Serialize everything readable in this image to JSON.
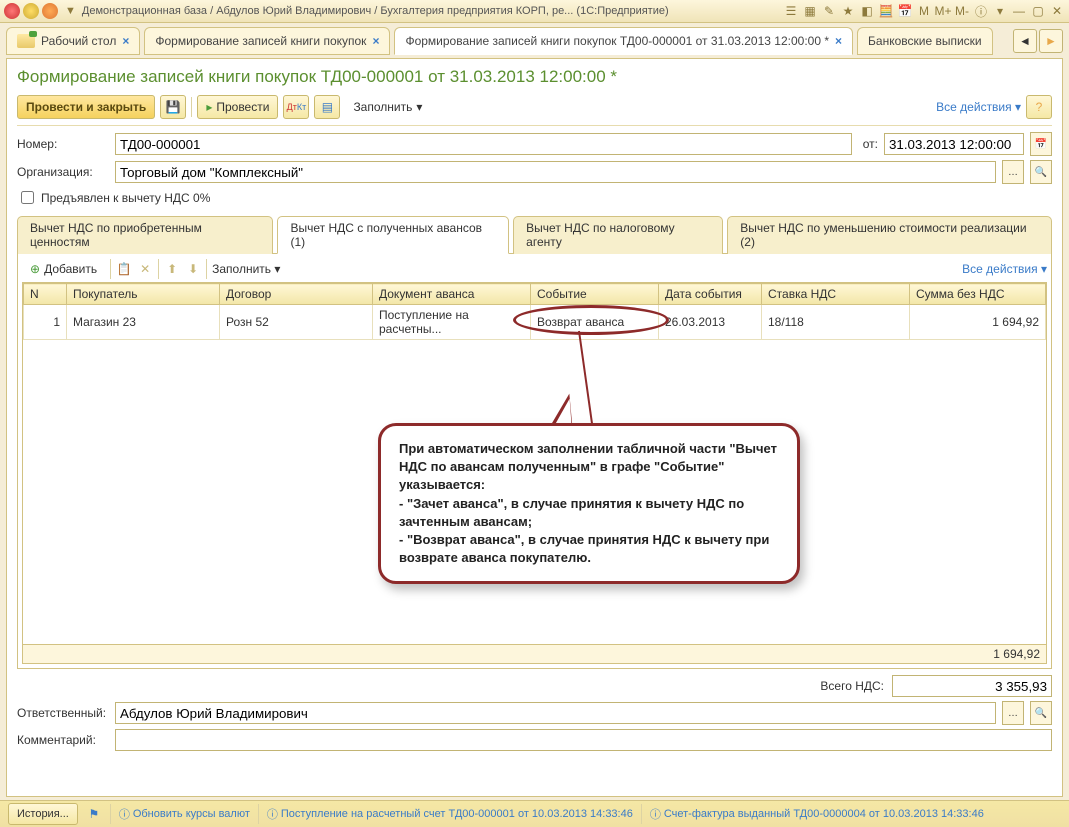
{
  "window": {
    "title": "Демонстрационная база / Абдулов Юрий Владимирович / Бухгалтерия предприятия КОРП, ре... (1С:Предприятие)"
  },
  "main_tabs": {
    "desktop": "Рабочий стол",
    "tab1": "Формирование записей книги покупок",
    "tab2": "Формирование записей книги покупок ТД00-000001 от 31.03.2013 12:00:00 *",
    "tab3": "Банковские выписки"
  },
  "doc_title": "Формирование записей книги покупок ТД00-000001 от 31.03.2013 12:00:00 *",
  "toolbar": {
    "post_close": "Провести и закрыть",
    "post": "Провести",
    "fill": "Заполнить",
    "all_actions": "Все действия"
  },
  "form": {
    "number_label": "Номер:",
    "number_value": "ТД00-000001",
    "date_label": "от:",
    "date_value": "31.03.2013 12:00:00",
    "org_label": "Организация:",
    "org_value": "Торговый дом \"Комплексный\"",
    "vat_zero_label": "Предъявлен к вычету НДС 0%"
  },
  "inner_tabs": {
    "t1": "Вычет НДС по приобретенным ценностям",
    "t2": "Вычет НДС с полученных авансов (1)",
    "t3": "Вычет НДС по налоговому агенту",
    "t4": "Вычет НДС по уменьшению стоимости реализации (2)"
  },
  "table_toolbar": {
    "add": "Добавить",
    "fill": "Заполнить",
    "all_actions": "Все действия"
  },
  "columns": {
    "n": "N",
    "buyer": "Покупатель",
    "contract": "Договор",
    "doc": "Документ аванса",
    "event": "Событие",
    "event_date": "Дата события",
    "rate": "Ставка НДС",
    "sum": "Сумма без НДС"
  },
  "rows": [
    {
      "n": "1",
      "buyer": "Магазин 23",
      "contract": "Розн 52",
      "doc": "Поступление на расчетны...",
      "event": "Возврат аванса",
      "event_date": "26.03.2013",
      "rate": "18/118",
      "sum": "1 694,92"
    }
  ],
  "column_total": "1 694,92",
  "totals": {
    "label": "Всего НДС:",
    "value": "3 355,93"
  },
  "responsible": {
    "label": "Ответственный:",
    "value": "Абдулов Юрий Владимирович"
  },
  "comment": {
    "label": "Комментарий:",
    "value": ""
  },
  "callout": {
    "line1": "При автоматическом заполнении табличной части \"Вычет НДС по авансам полученным\" в графе \"Событие\" указывается:",
    "line2": "- \"Зачет аванса\", в случае принятия к вычету НДС по зачтенным авансам;",
    "line3": "- \"Возврат аванса\", в случае принятия НДС к вычету при возврате аванса покупателю."
  },
  "status": {
    "history": "История...",
    "link1": "Обновить курсы валют",
    "link2": "Поступление на расчетный счет ТД00-000001 от 10.03.2013 14:33:46",
    "link3": "Счет-фактура выданный ТД00-0000004 от 10.03.2013 14:33:46"
  }
}
